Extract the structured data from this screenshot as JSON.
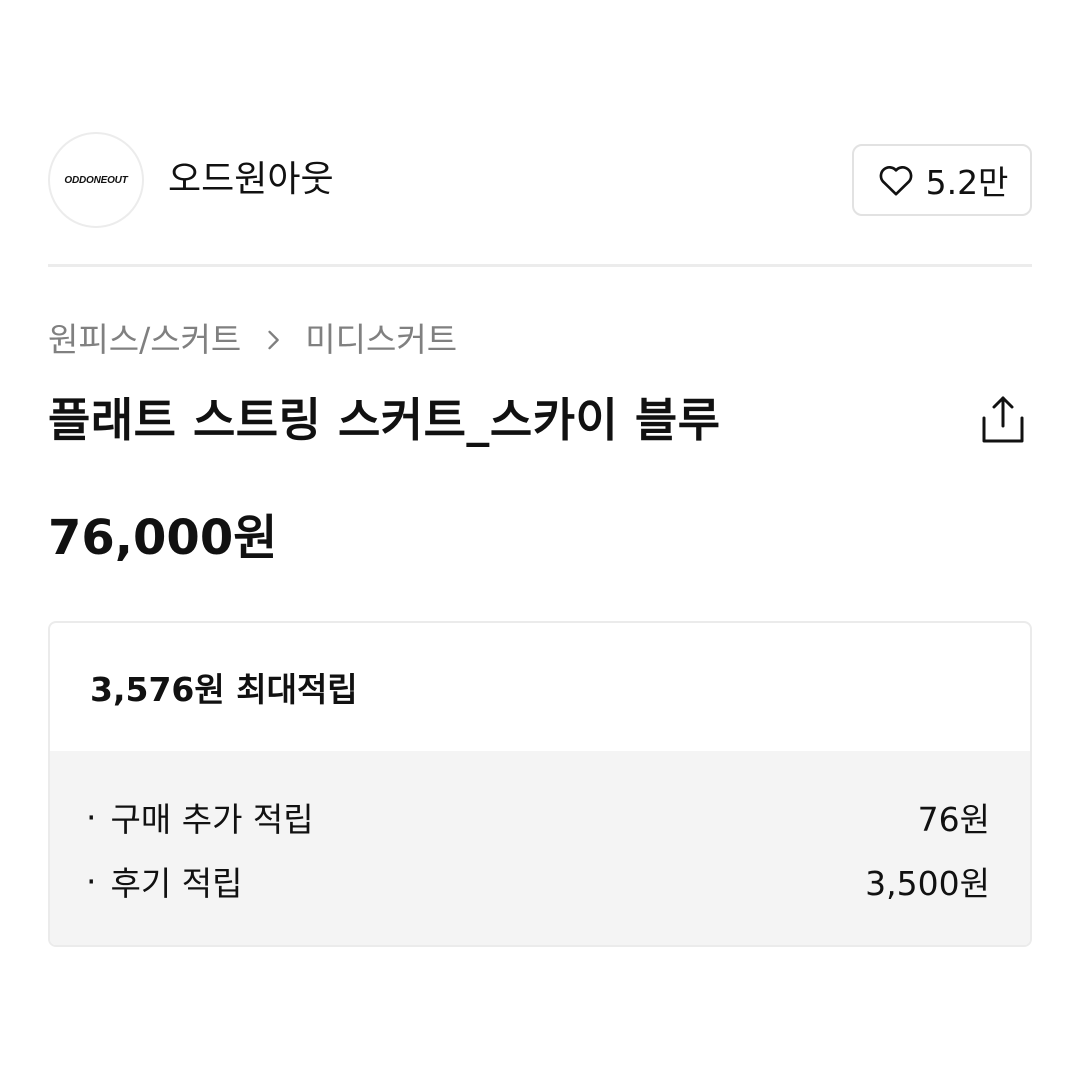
{
  "brand": {
    "logo_text": "ODDONEOUT",
    "name": "오드원아웃",
    "like_count": "5.2만"
  },
  "breadcrumb": {
    "items": [
      "원피스/스커트",
      "미디스커트"
    ]
  },
  "product": {
    "title": "플래트 스트링 스커트_스카이 블루",
    "price": "76,000원"
  },
  "points": {
    "summary": "3,576원 최대적립",
    "rows": [
      {
        "bullet": "·",
        "label": "구매 추가 적립",
        "value": "76원"
      },
      {
        "bullet": "·",
        "label": "후기 적립",
        "value": "3,500원"
      }
    ]
  },
  "icons": {
    "like": "heart-outline-icon",
    "breadcrumb_separator": "chevron-right-icon",
    "share": "share-upload-icon"
  }
}
